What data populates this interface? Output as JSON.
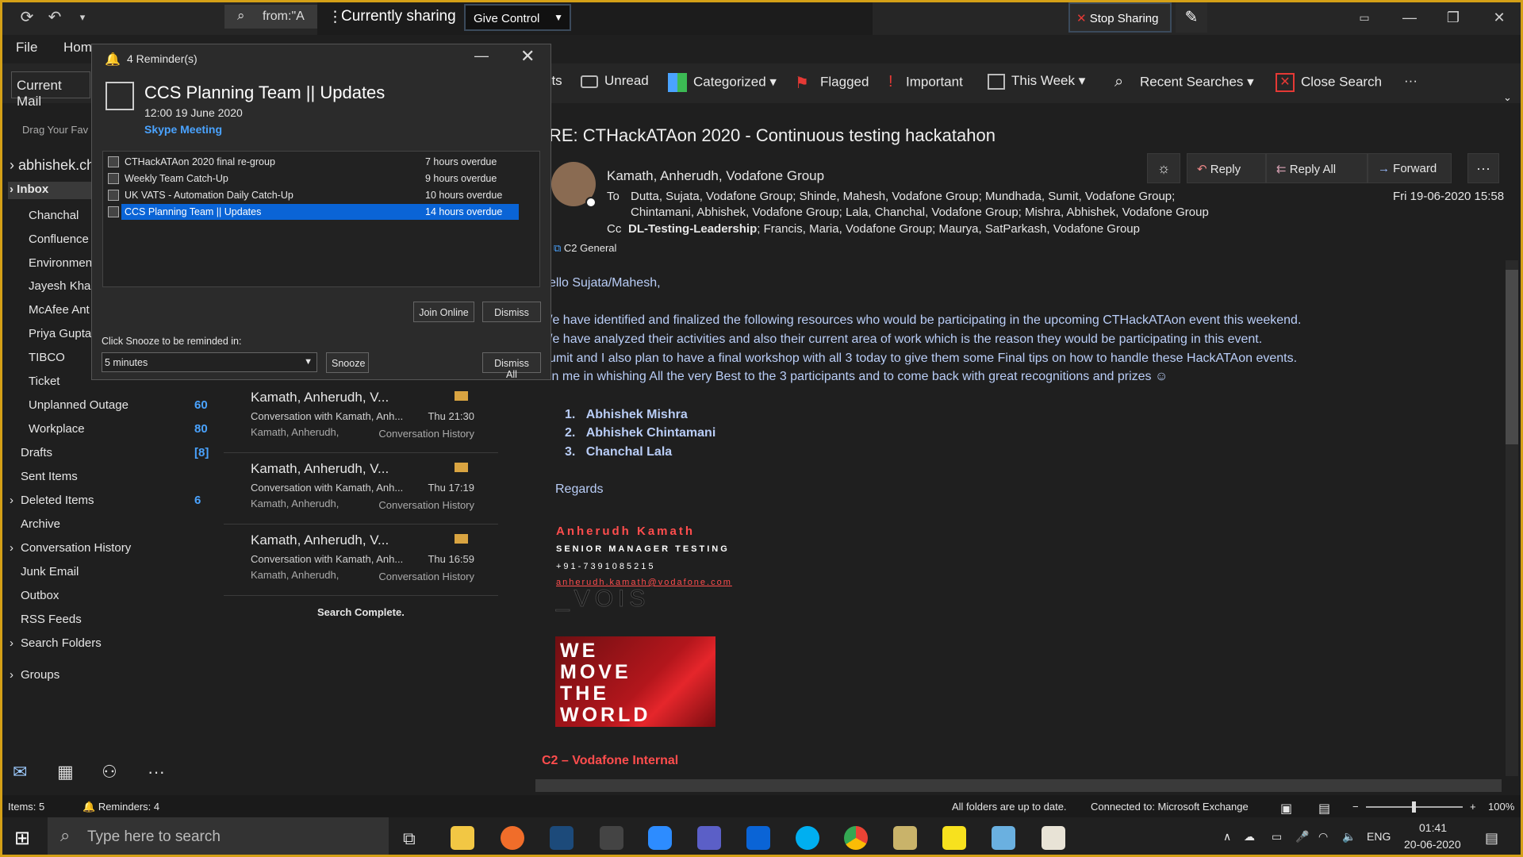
{
  "titlebar": {
    "search_text": "from:\"A",
    "sharing_text": "Currently sharing",
    "give_control": "Give Control",
    "stop_sharing": "Stop Sharing"
  },
  "menu": {
    "file": "File",
    "home": "Hom"
  },
  "ribbon": {
    "current_mail": "Current Mail",
    "items": [
      "nts",
      "Unread",
      "Categorized",
      "Flagged",
      "Important",
      "This Week",
      "Recent Searches",
      "Close Search",
      "···"
    ]
  },
  "nav": {
    "drag_hint": "Drag Your Fav",
    "account": "abhishek.ch",
    "inbox": "Inbox",
    "folders": [
      {
        "label": "Chanchal",
        "count": ""
      },
      {
        "label": "Confluence",
        "count": ""
      },
      {
        "label": "Environmen",
        "count": ""
      },
      {
        "label": "Jayesh Khan",
        "count": ""
      },
      {
        "label": "McAfee Ant",
        "count": ""
      },
      {
        "label": "Priya Gupta",
        "count": ""
      },
      {
        "label": "TIBCO",
        "count": ""
      },
      {
        "label": "Ticket",
        "count": ""
      },
      {
        "label": "Unplanned Outage",
        "count": "60"
      },
      {
        "label": "Workplace",
        "count": "80"
      }
    ],
    "top_folders": [
      {
        "label": "Drafts",
        "count": "[8]"
      },
      {
        "label": "Sent Items",
        "count": ""
      },
      {
        "label": "Deleted Items",
        "count": "6"
      },
      {
        "label": "Archive",
        "count": ""
      },
      {
        "label": "Conversation History",
        "count": ""
      },
      {
        "label": "Junk Email",
        "count": ""
      },
      {
        "label": "Outbox",
        "count": ""
      },
      {
        "label": "RSS Feeds",
        "count": ""
      },
      {
        "label": "Search Folders",
        "count": ""
      },
      {
        "label": "Groups",
        "count": ""
      }
    ]
  },
  "messages": [
    {
      "from": "Kamath, Anherudh, V...",
      "subject": "Conversation with Kamath, Anh...",
      "preview": "Kamath, Anherudh,",
      "time": "Thu 21:30",
      "folder": "Conversation History"
    },
    {
      "from": "Kamath, Anherudh, V...",
      "subject": "Conversation with Kamath, Anh...",
      "preview": "Kamath, Anherudh,",
      "time": "Thu 17:19",
      "folder": "Conversation History"
    },
    {
      "from": "Kamath, Anherudh, V...",
      "subject": "Conversation with Kamath, Anh...",
      "preview": "Kamath, Anherudh,",
      "time": "Thu 16:59",
      "folder": "Conversation History"
    }
  ],
  "search_complete": "Search Complete.",
  "email": {
    "subject": "RE: CTHackATAon 2020 - Continuous testing hackatahon",
    "sender": "Kamath, Anherudh, Vodafone Group",
    "actions": {
      "reply": "Reply",
      "reply_all": "Reply All",
      "forward": "Forward"
    },
    "to_label": "To",
    "to_line1": "Dutta, Sujata, Vodafone Group;  Shinde, Mahesh, Vodafone Group;  Mundhada, Sumit, Vodafone Group;",
    "to_line2": "Chintamani, Abhishek, Vodafone Group;  Lala, Chanchal, Vodafone Group;  Mishra, Abhishek, Vodafone Group",
    "cc_label": "Cc",
    "cc_line_bold": "DL-Testing-Leadership",
    "cc_line": ";  Francis, Maria, Vodafone Group;  Maurya, SatParkash, Vodafone Group",
    "date": "Fri 19-06-2020 15:58",
    "classification": "C2 General",
    "greeting": "ello Sujata/Mahesh,",
    "body": [
      "/e have identified and finalized the following resources who would be participating in the upcoming CTHackATAon event this weekend.",
      "/e have analyzed their activities and also their current area of work which is the reason they would be participating in this event.",
      "umit and I also plan to have a final workshop with all 3 today to give them some Final tips on how to handle these HackATAon events.",
      "in me in whishing All the very Best to the 3 participants and to come back with great recognitions and prizes ☺"
    ],
    "participants": [
      "Abhishek Mishra",
      "Abhishek Chintamani",
      "Chanchal Lala"
    ],
    "regards": "Regards",
    "sig_name": "Anherudh Kamath",
    "sig_title": "SENIOR MANAGER TESTING",
    "sig_phone": "+91-7391085215",
    "sig_email": "anherudh.kamath@vodafone.com",
    "sig_logo": "_VOIS",
    "banner": [
      "WE",
      "MOVE",
      "THE",
      "WORLD"
    ],
    "footer": "C2 – Vodafone Internal"
  },
  "reminder": {
    "title": "4 Reminder(s)",
    "subject": "CCS Planning Team || Updates",
    "time": "12:00 19 June 2020",
    "location": "Skype Meeting",
    "items": [
      {
        "name": "CTHackATAon 2020 final re-group",
        "overdue": "7 hours overdue"
      },
      {
        "name": "Weekly Team Catch-Up",
        "overdue": "9 hours overdue"
      },
      {
        "name": "UK VATS - Automation Daily Catch-Up",
        "overdue": "10 hours overdue"
      },
      {
        "name": "CCS Planning Team || Updates",
        "overdue": "14 hours overdue"
      }
    ],
    "join_online": "Join Online",
    "dismiss": "Dismiss",
    "snooze_label": "Click Snooze to be reminded in:",
    "snooze_value": "5 minutes",
    "snooze": "Snooze",
    "dismiss_all": "Dismiss All"
  },
  "status": {
    "items": "Items: 5",
    "reminders": "Reminders: 4",
    "folders": "All folders are up to date.",
    "connected": "Connected to: Microsoft Exchange",
    "zoom": "100%"
  },
  "taskbar": {
    "search_placeholder": "Type here to search",
    "lang": "ENG",
    "time": "01:41",
    "date": "20-06-2020"
  },
  "colors": {
    "accent": "#0a64d6",
    "link": "#4aa3ff",
    "sig_red": "#ff4d4d"
  }
}
